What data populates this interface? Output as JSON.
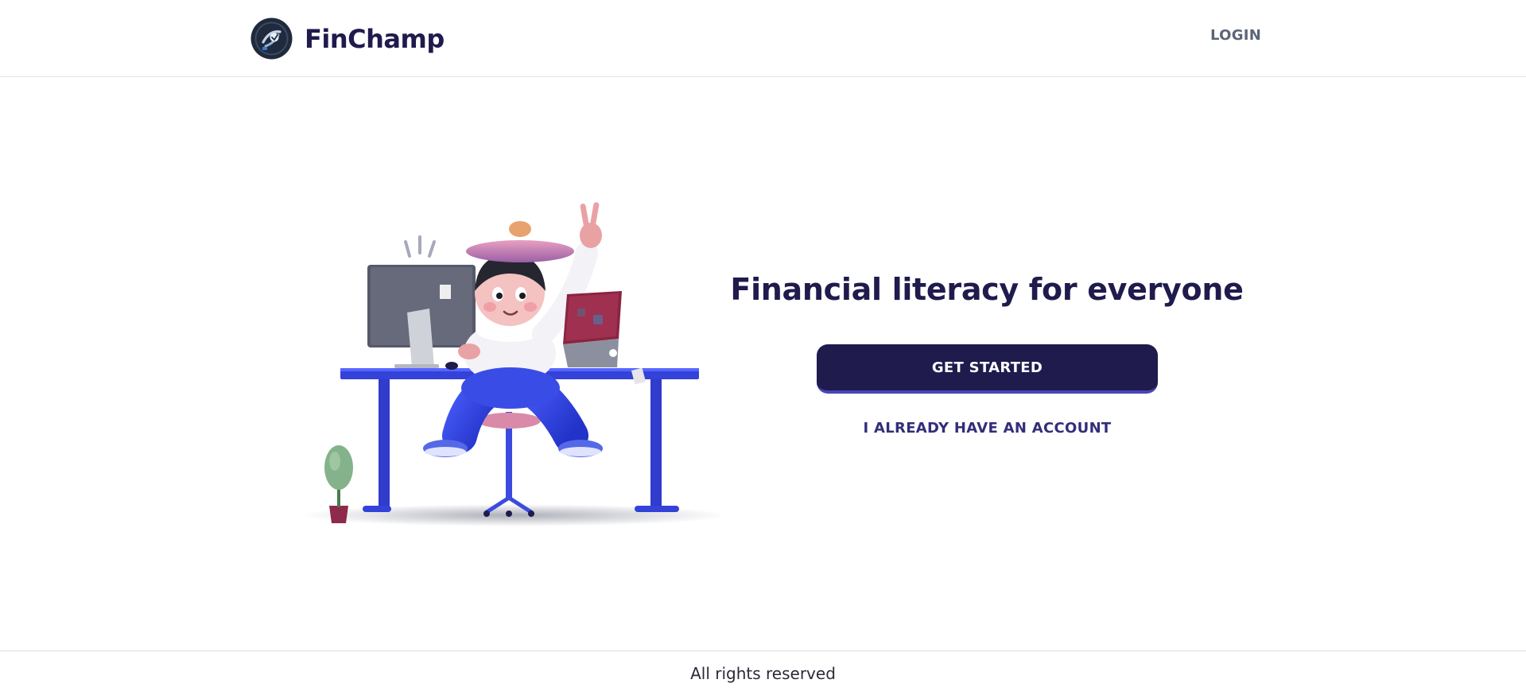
{
  "header": {
    "brand_name": "FinChamp",
    "nav": {
      "login_label": "LOGIN"
    }
  },
  "hero": {
    "headline": "Financial literacy for everyone",
    "primary_cta_label": "GET STARTED",
    "secondary_cta_label": "I ALREADY HAVE AN ACCOUNT",
    "illustration": "person-at-desk-illustration"
  },
  "footer": {
    "text": "All rights reserved"
  },
  "colors": {
    "brand_navy": "#1f1b4d",
    "button_accent": "#4a45b8",
    "nav_text": "#5b6478",
    "illustration_blue": "#3442d9"
  },
  "icons": {
    "logo": "finchamp-logo-icon"
  }
}
